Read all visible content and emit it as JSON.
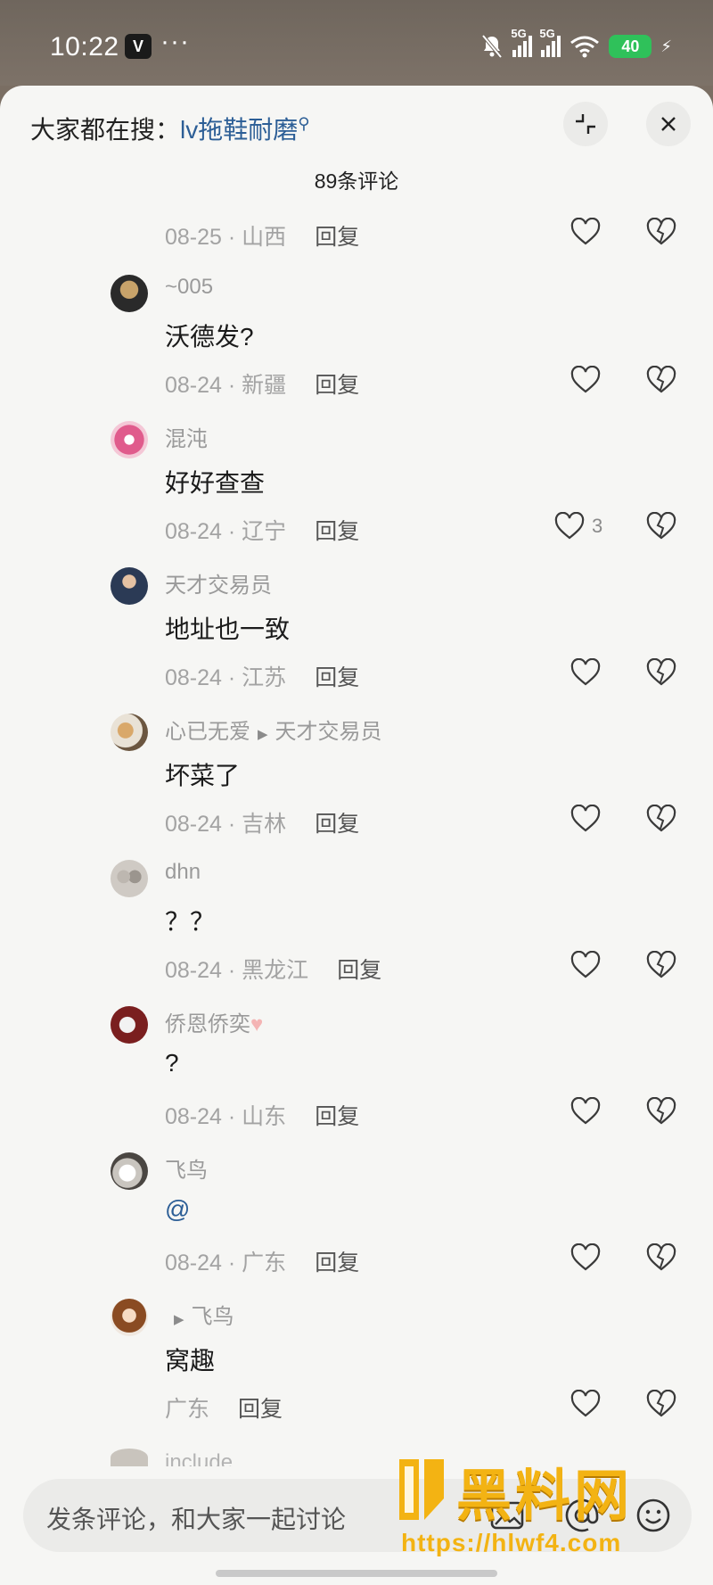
{
  "status_bar": {
    "time": "10:22",
    "app_badge": "V",
    "more": "···",
    "network": [
      "5G",
      "5G"
    ],
    "battery": "40"
  },
  "search_hint": {
    "prefix": "大家都在搜：",
    "keyword": "lv拖鞋耐磨"
  },
  "comment_count": "89条评论",
  "comments": [
    {
      "meta_date": "08-25",
      "meta_region": "山西",
      "reply": "回复"
    },
    {
      "user": "~005",
      "text": "沃德发?",
      "meta_date": "08-24",
      "meta_region": "新疆",
      "reply": "回复"
    },
    {
      "user": "混沌",
      "text": "好好查查",
      "meta_date": "08-24",
      "meta_region": "辽宁",
      "reply": "回复",
      "likes": "3"
    },
    {
      "user": "天才交易员",
      "text": "地址也一致",
      "meta_date": "08-24",
      "meta_region": "江苏",
      "reply": "回复"
    },
    {
      "user": "心已无爱",
      "reply_to": "天才交易员",
      "text": "坏菜了",
      "meta_date": "08-24",
      "meta_region": "吉林",
      "reply": "回复"
    },
    {
      "user": "dhn",
      "text": "？？",
      "meta_date": "08-24",
      "meta_region": "黑龙江",
      "reply": "回复"
    },
    {
      "user": "侨恩侨奕",
      "text": "?",
      "meta_date": "08-24",
      "meta_region": "山东",
      "reply": "回复"
    },
    {
      "user": "飞鸟",
      "text": "@",
      "meta_date": "08-24",
      "meta_region": "广东",
      "reply": "回复"
    },
    {
      "reply_to": "飞鸟",
      "text": "窝趣",
      "meta_region": "广东",
      "reply": "回复"
    }
  ],
  "partial_user": "include",
  "input": {
    "placeholder": "发条评论，和大家一起讨论"
  },
  "watermark": {
    "brand": "黑料网",
    "url": "https://hlwf4.com"
  },
  "colors": {
    "accent_blue": "#2c5e96",
    "sheet_bg": "#f6f6f4",
    "battery_green": "#2fc15a",
    "watermark_gold": "#f3b313"
  }
}
